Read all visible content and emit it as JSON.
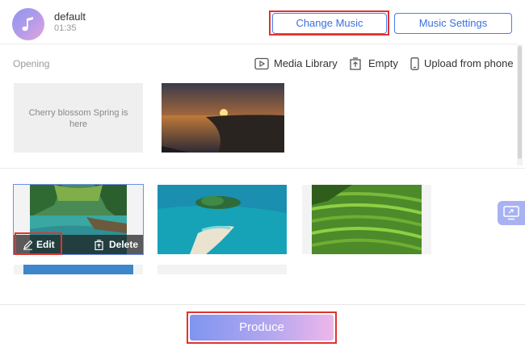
{
  "music": {
    "name": "default",
    "duration": "01:35",
    "icon": "music-note-icon",
    "change_label": "Change Music",
    "settings_label": "Music Settings"
  },
  "opening": {
    "label": "Opening",
    "placeholder_text": "Cherry blossom Spring is here",
    "tools": {
      "media_library": "Media Library",
      "empty": "Empty",
      "upload": "Upload from phone"
    }
  },
  "photo_actions": {
    "edit_label": "Edit",
    "delete_label": "Delete"
  },
  "footer": {
    "produce_label": "Produce"
  },
  "colors": {
    "accent": "#4b7de9",
    "highlight": "#e0332e",
    "produce_start": "#7f95f0",
    "produce_end": "#eeb7ea"
  }
}
